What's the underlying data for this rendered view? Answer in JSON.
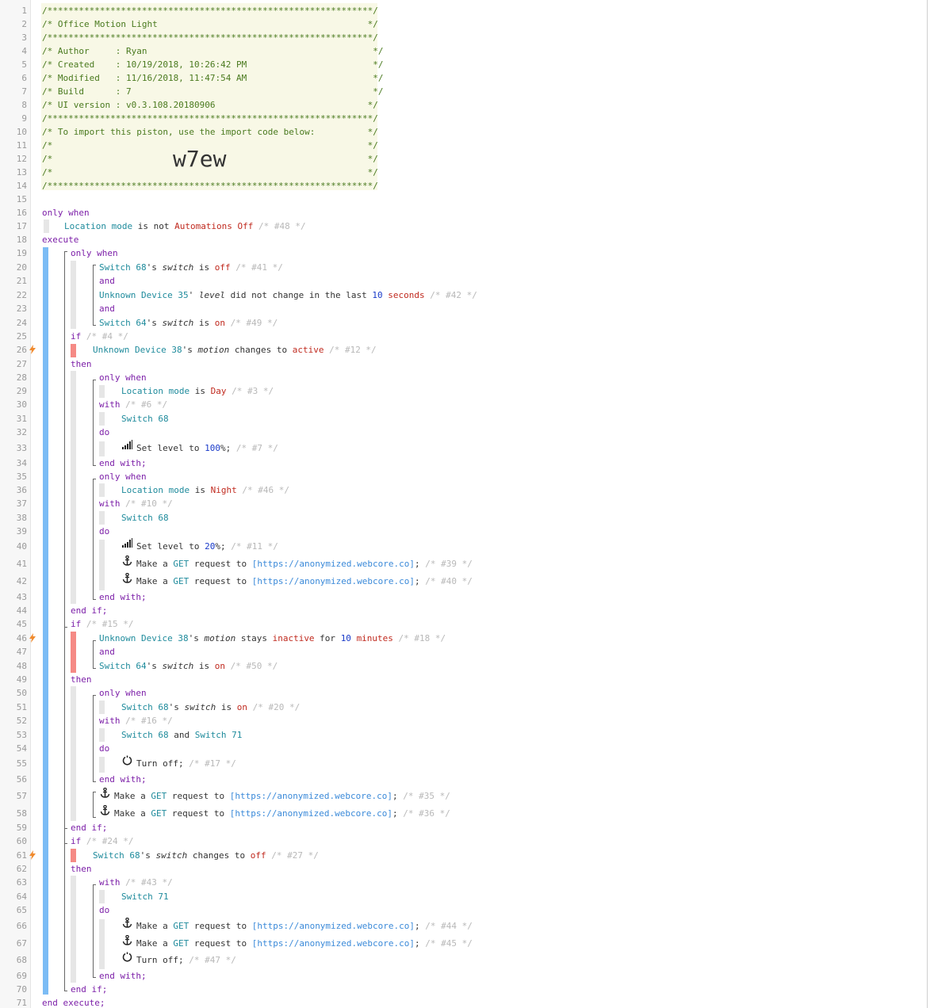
{
  "header": {
    "border": "/**************************************************************/",
    "title": "/* Office Motion Light                                        */",
    "author": "/* Author     : Ryan                                           */",
    "created": "/* Created    : 10/19/2018, 10:26:42 PM                        */",
    "modified": "/* Modified   : 11/16/2018, 11:47:54 AM                        */",
    "build": "/* Build      : 7                                              */",
    "ui_version": "/* UI version : v0.3.108.20180906                             */",
    "import_line": "/* To import this piston, use the import code below:          */",
    "blank_line": "/*                                                            */",
    "import_code": "w7ew"
  },
  "icon_names": {
    "trigger": "lightning-icon",
    "level": "signal-bars-icon",
    "http": "anchor-icon",
    "power": "power-icon"
  },
  "colors": {
    "keyword": "#7c1fa8",
    "device": "#1f8b9c",
    "value": "#c02a1f",
    "number": "#1a3bc9",
    "comment": "#b8b8b8",
    "url": "#3b8ad9",
    "block_bar": "#7cbcf5",
    "trigger_bar": "#f58a85",
    "trigger_icon": "#f08a2e"
  },
  "code": {
    "l16": "only when",
    "l17": [
      [
        "Location mode",
        "dev"
      ],
      [
        " is not ",
        ""
      ],
      [
        "Automations Off",
        "val"
      ],
      [
        " /* #48 */",
        "cmt"
      ]
    ],
    "l18": "execute",
    "l19": "only when",
    "l20": [
      [
        "Switch 68",
        "dev"
      ],
      [
        "'s ",
        ""
      ],
      [
        "switch",
        "it"
      ],
      [
        " is ",
        ""
      ],
      [
        "off",
        "val"
      ],
      [
        " /* #41 */",
        "cmt"
      ]
    ],
    "l21": "and",
    "l22": [
      [
        "Unknown Device 35",
        "dev"
      ],
      [
        "' ",
        ""
      ],
      [
        "level",
        "it"
      ],
      [
        " did not change in the last ",
        ""
      ],
      [
        "10",
        "num"
      ],
      [
        " ",
        ""
      ],
      [
        "seconds",
        "val"
      ],
      [
        " /* #42 */",
        "cmt"
      ]
    ],
    "l23": "and",
    "l24": [
      [
        "Switch 64",
        "dev"
      ],
      [
        "'s ",
        ""
      ],
      [
        "switch",
        "it"
      ],
      [
        " is ",
        ""
      ],
      [
        "on",
        "val"
      ],
      [
        " /* #49 */",
        "cmt"
      ]
    ],
    "l25": [
      [
        "if",
        "kw"
      ],
      [
        " /* #4 */",
        "cmt"
      ]
    ],
    "l26": [
      [
        "Unknown Device 38",
        "dev"
      ],
      [
        "'s ",
        ""
      ],
      [
        "motion",
        "it"
      ],
      [
        " changes to ",
        ""
      ],
      [
        "active",
        "val"
      ],
      [
        " /* #12 */",
        "cmt"
      ]
    ],
    "l27": "then",
    "l28": "only when",
    "l29": [
      [
        "Location mode",
        "dev"
      ],
      [
        " is ",
        ""
      ],
      [
        "Day",
        "val"
      ],
      [
        " /* #3 */",
        "cmt"
      ]
    ],
    "l30": [
      [
        "with",
        "kw"
      ],
      [
        " /* #6 */",
        "cmt"
      ]
    ],
    "l31": [
      [
        "Switch 68",
        "dev"
      ]
    ],
    "l32": "do",
    "l33": [
      [
        "Set level to ",
        "cmd"
      ],
      [
        "100",
        "num"
      ],
      [
        "%;",
        ""
      ],
      [
        " /* #7 */",
        "cmt"
      ]
    ],
    "l34": "end with;",
    "l35": "only when",
    "l36": [
      [
        "Location mode",
        "dev"
      ],
      [
        " is ",
        ""
      ],
      [
        "Night",
        "val"
      ],
      [
        " /* #46 */",
        "cmt"
      ]
    ],
    "l37": [
      [
        "with",
        "kw"
      ],
      [
        " /* #10 */",
        "cmt"
      ]
    ],
    "l38": [
      [
        "Switch 68",
        "dev"
      ]
    ],
    "l39": "do",
    "l40": [
      [
        "Set level to ",
        "cmd"
      ],
      [
        "20",
        "num"
      ],
      [
        "%;",
        ""
      ],
      [
        " /* #11 */",
        "cmt"
      ]
    ],
    "l41": [
      [
        "Make a ",
        "cmd"
      ],
      [
        "GET",
        "dev"
      ],
      [
        " request to ",
        ""
      ],
      [
        "[https://anonymized.webcore.co]",
        "url"
      ],
      [
        ";",
        ""
      ],
      [
        " /* #39 */",
        "cmt"
      ]
    ],
    "l42": [
      [
        "Make a ",
        "cmd"
      ],
      [
        "GET",
        "dev"
      ],
      [
        " request to ",
        ""
      ],
      [
        "[https://anonymized.webcore.co]",
        "url"
      ],
      [
        ";",
        ""
      ],
      [
        " /* #40 */",
        "cmt"
      ]
    ],
    "l43": "end with;",
    "l44": "end if;",
    "l45": [
      [
        "if",
        "kw"
      ],
      [
        " /* #15 */",
        "cmt"
      ]
    ],
    "l46": [
      [
        "Unknown Device 38",
        "dev"
      ],
      [
        "'s ",
        ""
      ],
      [
        "motion",
        "it"
      ],
      [
        " stays ",
        ""
      ],
      [
        "inactive",
        "val"
      ],
      [
        " for ",
        ""
      ],
      [
        "10",
        "num"
      ],
      [
        " ",
        ""
      ],
      [
        "minutes",
        "val"
      ],
      [
        " /* #18 */",
        "cmt"
      ]
    ],
    "l47": "and",
    "l48": [
      [
        "Switch 64",
        "dev"
      ],
      [
        "'s ",
        ""
      ],
      [
        "switch",
        "it"
      ],
      [
        " is ",
        ""
      ],
      [
        "on",
        "val"
      ],
      [
        " /* #50 */",
        "cmt"
      ]
    ],
    "l49": "then",
    "l50": "only when",
    "l51": [
      [
        "Switch 68",
        "dev"
      ],
      [
        "'s ",
        ""
      ],
      [
        "switch",
        "it"
      ],
      [
        " is ",
        ""
      ],
      [
        "on",
        "val"
      ],
      [
        " /* #20 */",
        "cmt"
      ]
    ],
    "l52": [
      [
        "with",
        "kw"
      ],
      [
        " /* #16 */",
        "cmt"
      ]
    ],
    "l53": [
      [
        "Switch 68",
        "dev"
      ],
      [
        " and ",
        ""
      ],
      [
        "Switch 71",
        "dev"
      ]
    ],
    "l54": "do",
    "l55": [
      [
        "Turn off;",
        "cmd"
      ],
      [
        " /* #17 */",
        "cmt"
      ]
    ],
    "l56": "end with;",
    "l57": [
      [
        "Make a ",
        "cmd"
      ],
      [
        "GET",
        "dev"
      ],
      [
        " request to ",
        ""
      ],
      [
        "[https://anonymized.webcore.co]",
        "url"
      ],
      [
        ";",
        ""
      ],
      [
        " /* #35 */",
        "cmt"
      ]
    ],
    "l58": [
      [
        "Make a ",
        "cmd"
      ],
      [
        "GET",
        "dev"
      ],
      [
        " request to ",
        ""
      ],
      [
        "[https://anonymized.webcore.co]",
        "url"
      ],
      [
        ";",
        ""
      ],
      [
        " /* #36 */",
        "cmt"
      ]
    ],
    "l59": "end if;",
    "l60": [
      [
        "if",
        "kw"
      ],
      [
        " /* #24 */",
        "cmt"
      ]
    ],
    "l61": [
      [
        "Switch 68",
        "dev"
      ],
      [
        "'s ",
        ""
      ],
      [
        "switch",
        "it"
      ],
      [
        " changes to ",
        ""
      ],
      [
        "off",
        "val"
      ],
      [
        " /* #27 */",
        "cmt"
      ]
    ],
    "l62": "then",
    "l63": [
      [
        "with",
        "kw"
      ],
      [
        " /* #43 */",
        "cmt"
      ]
    ],
    "l64": [
      [
        "Switch 71",
        "dev"
      ]
    ],
    "l65": "do",
    "l66": [
      [
        "Make a ",
        "cmd"
      ],
      [
        "GET",
        "dev"
      ],
      [
        " request to ",
        ""
      ],
      [
        "[https://anonymized.webcore.co]",
        "url"
      ],
      [
        ";",
        ""
      ],
      [
        " /* #44 */",
        "cmt"
      ]
    ],
    "l67": [
      [
        "Make a ",
        "cmd"
      ],
      [
        "GET",
        "dev"
      ],
      [
        " request to ",
        ""
      ],
      [
        "[https://anonymized.webcore.co]",
        "url"
      ],
      [
        ";",
        ""
      ],
      [
        " /* #45 */",
        "cmt"
      ]
    ],
    "l68": [
      [
        "Turn off;",
        "cmd"
      ],
      [
        " /* #47 */",
        "cmt"
      ]
    ],
    "l69": "end with;",
    "l70": "end if;",
    "l71": "end execute;"
  }
}
